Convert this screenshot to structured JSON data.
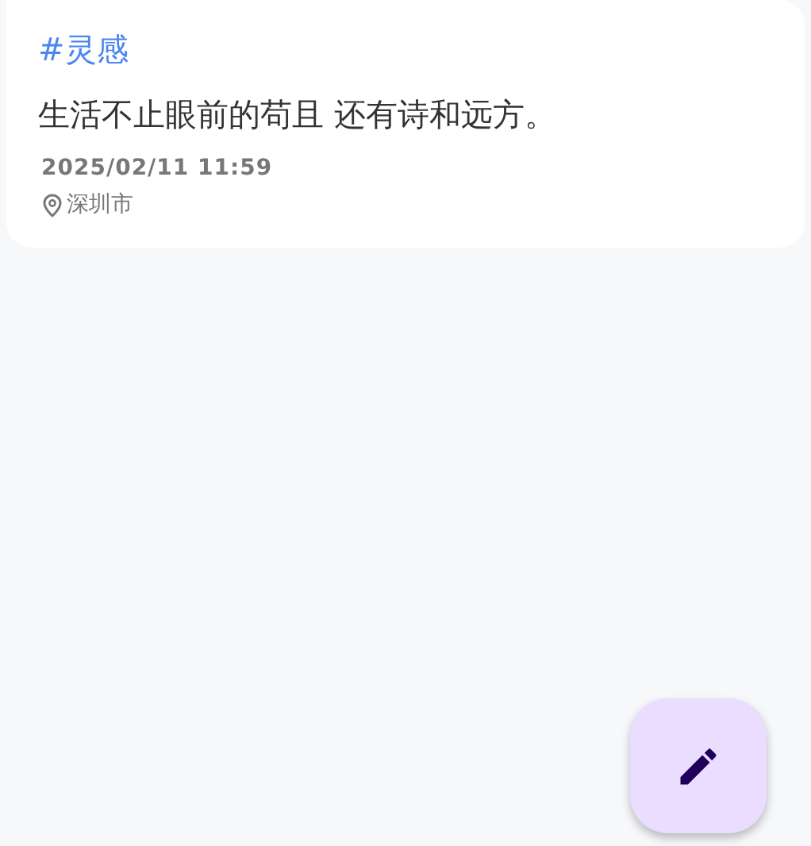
{
  "notes": [
    {
      "tag": "#灵感",
      "content": "生活不止眼前的苟且 还有诗和远方。",
      "date": "2025/02/11 11:59",
      "location": "深圳市"
    }
  ],
  "fab": {
    "kind": "edit"
  }
}
